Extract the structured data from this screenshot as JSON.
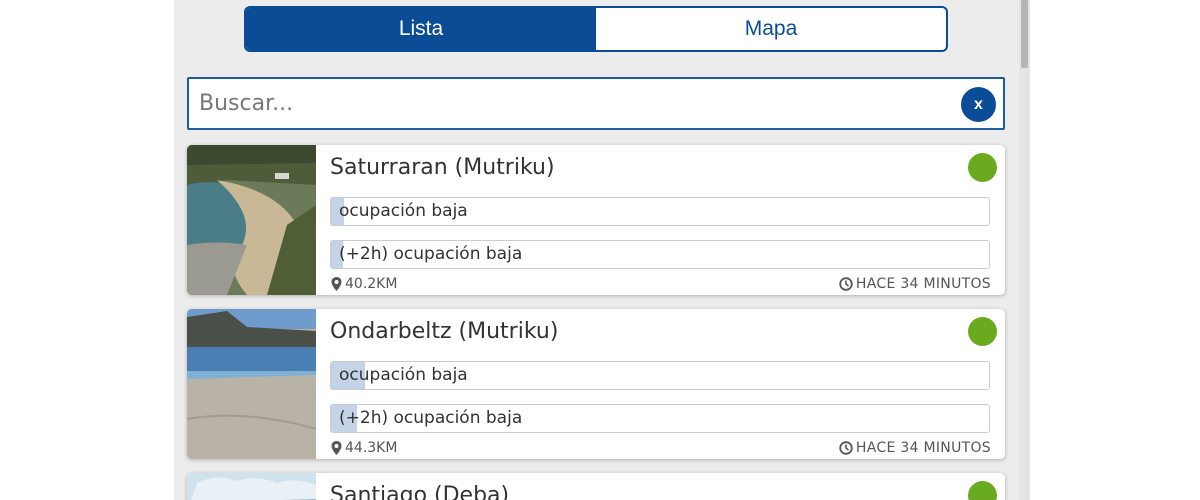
{
  "tabs": [
    {
      "label": "Lista",
      "active": true
    },
    {
      "label": "Mapa",
      "active": false
    }
  ],
  "search": {
    "placeholder": "Buscar...",
    "value": "",
    "clear_label": "x"
  },
  "colors": {
    "brand": "#0a4d96",
    "status_green": "#6aaa1e",
    "bar_fill": "#c5d3e6"
  },
  "beaches": [
    {
      "name": "Saturraran (Mutriku)",
      "status": "green",
      "occupancy_now": "ocupación baja",
      "occupancy_now_level": 0.02,
      "occupancy_2h": "(+2h) ocupación baja",
      "occupancy_2h_level": 0.02,
      "distance": "40.2KM",
      "updated": "HACE 34 MINUTOS",
      "distance_icon": "location-pin-icon",
      "updated_icon": "clock-icon"
    },
    {
      "name": "Ondarbeltz (Mutriku)",
      "status": "green",
      "occupancy_now": "ocupación baja",
      "occupancy_now_level": 0.05,
      "occupancy_2h": "(+2h) ocupación baja",
      "occupancy_2h_level": 0.04,
      "distance": "44.3KM",
      "updated": "HACE 34 MINUTOS",
      "distance_icon": "location-pin-icon",
      "updated_icon": "clock-icon"
    },
    {
      "name": "Santiago (Deba)",
      "status": "green"
    }
  ]
}
